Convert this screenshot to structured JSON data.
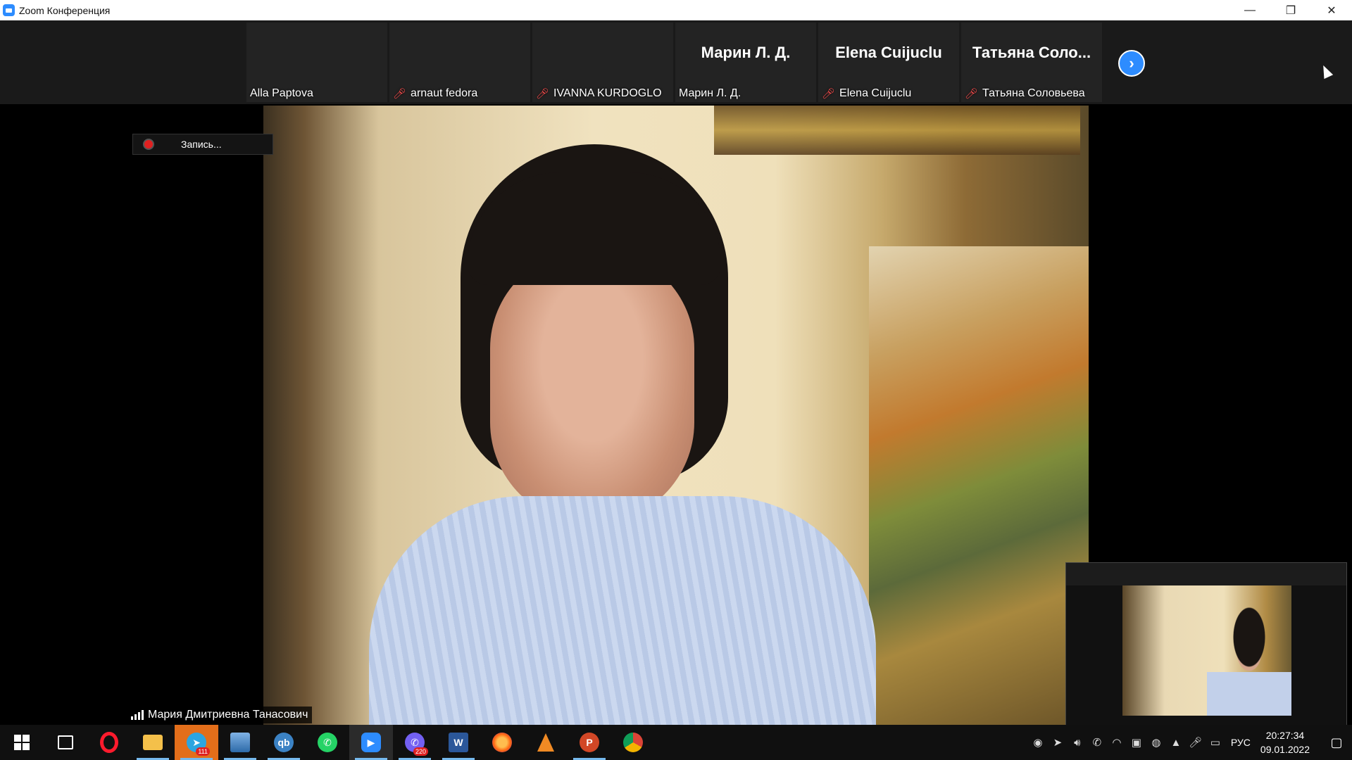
{
  "window": {
    "title": "Zoom Конференция",
    "controls": {
      "minimize": "—",
      "restore": "❐",
      "close": "✕"
    }
  },
  "gallery": {
    "participants": [
      {
        "label": "Alla Paptova",
        "muted": false,
        "video": true
      },
      {
        "label": "arnaut fedora",
        "muted": true,
        "video": false
      },
      {
        "label": "IVANNA KURDOGLO",
        "muted": true,
        "video": true
      },
      {
        "big_name": "Марин Л. Д.",
        "label": "Марин Л. Д.",
        "muted": false,
        "video": false
      },
      {
        "big_name": "Elena Cuijuclu",
        "label": "Elena Cuijuclu",
        "muted": true,
        "video": false
      },
      {
        "big_name": "Татьяна Соло...",
        "label": "Татьяна Соловьева",
        "muted": true,
        "video": false
      }
    ],
    "next_icon": "›",
    "mute_icon": "mic-off-icon"
  },
  "recording": {
    "label": "Запись..."
  },
  "active_speaker": {
    "name": "Мария Дмитриевна Танасович"
  },
  "taskbar": {
    "telegram_badge": "111",
    "viber_badge": "220",
    "apps": [
      "start",
      "task-view",
      "opera",
      "file-explorer",
      "telegram",
      "photos",
      "qbittorrent",
      "whatsapp",
      "zoom",
      "viber",
      "word",
      "firefox",
      "vlc",
      "powerpoint",
      "chrome"
    ],
    "icon_texts": {
      "qb": "qb",
      "word": "W",
      "ppt": "P"
    }
  },
  "tray": {
    "language": "РУС",
    "time": "20:27:34",
    "date": "09.01.2022"
  },
  "colors": {
    "zoom_blue": "#2d8cff",
    "mute_red": "#ff4d4d",
    "taskbar": "#101010",
    "telegram_highlight": "#e36e1a"
  }
}
